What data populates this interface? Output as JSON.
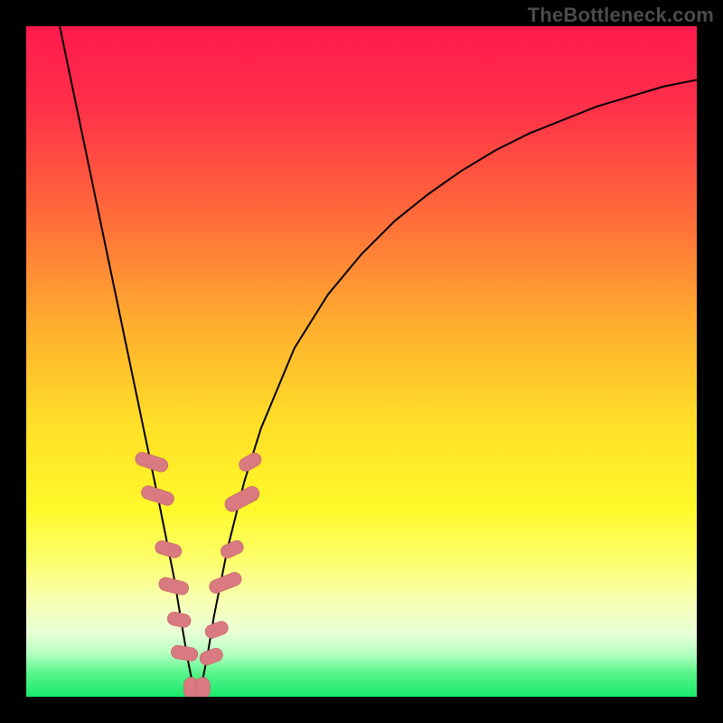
{
  "watermark": "TheBottleneck.com",
  "colors": {
    "frame": "#000000",
    "watermark": "#4b4b4b",
    "gradient_stops": [
      {
        "offset": 0.0,
        "color": "#ff1a4d"
      },
      {
        "offset": 0.12,
        "color": "#ff3049"
      },
      {
        "offset": 0.28,
        "color": "#ff6a3a"
      },
      {
        "offset": 0.45,
        "color": "#ffb02e"
      },
      {
        "offset": 0.6,
        "color": "#ffe128"
      },
      {
        "offset": 0.72,
        "color": "#fff92a"
      },
      {
        "offset": 0.8,
        "color": "#fcff6f"
      },
      {
        "offset": 0.86,
        "color": "#f7ffb6"
      },
      {
        "offset": 0.905,
        "color": "#e8ffd6"
      },
      {
        "offset": 0.935,
        "color": "#b6ffc1"
      },
      {
        "offset": 0.965,
        "color": "#57f48a"
      },
      {
        "offset": 1.0,
        "color": "#19e86b"
      }
    ],
    "curve": "#000000",
    "marker_fill": "#d97a80",
    "marker_stroke": "#c5636a"
  },
  "chart_data": {
    "type": "line",
    "title": "",
    "xlabel": "",
    "ylabel": "",
    "xlim": [
      0,
      100
    ],
    "ylim": [
      0,
      100
    ],
    "grid": false,
    "series": [
      {
        "name": "bottleneck-curve",
        "x": [
          5,
          7.5,
          10,
          12.5,
          15,
          17.5,
          20,
          21,
          22,
          23,
          24,
          25,
          26,
          27,
          28,
          30,
          32.5,
          35,
          40,
          45,
          50,
          55,
          60,
          65,
          70,
          75,
          80,
          85,
          90,
          95,
          100
        ],
        "y": [
          100,
          88,
          76,
          64,
          52,
          40,
          28,
          23,
          18,
          12,
          6,
          1,
          1,
          6,
          12,
          22,
          32,
          40,
          52,
          60,
          66,
          71,
          75,
          78.5,
          81.5,
          84,
          86,
          88,
          89.5,
          91,
          92
        ]
      }
    ],
    "markers": [
      {
        "shape": "pill",
        "x": 18.7,
        "y": 35.0,
        "w": 2.0,
        "h": 5.0,
        "angle": -72
      },
      {
        "shape": "pill",
        "x": 19.6,
        "y": 30.0,
        "w": 2.0,
        "h": 5.0,
        "angle": -72
      },
      {
        "shape": "pill",
        "x": 21.2,
        "y": 22.0,
        "w": 2.0,
        "h": 4.0,
        "angle": -74
      },
      {
        "shape": "pill",
        "x": 22.0,
        "y": 16.5,
        "w": 2.0,
        "h": 4.5,
        "angle": -76
      },
      {
        "shape": "pill",
        "x": 22.8,
        "y": 11.5,
        "w": 2.0,
        "h": 3.5,
        "angle": -78
      },
      {
        "shape": "pill",
        "x": 23.6,
        "y": 6.5,
        "w": 2.0,
        "h": 4.0,
        "angle": -80
      },
      {
        "shape": "pill",
        "x": 24.6,
        "y": 1.3,
        "w": 2.2,
        "h": 3.2,
        "angle": 0
      },
      {
        "shape": "pill",
        "x": 26.3,
        "y": 1.3,
        "w": 2.2,
        "h": 3.2,
        "angle": 0
      },
      {
        "shape": "pill",
        "x": 27.6,
        "y": 6.0,
        "w": 2.0,
        "h": 3.5,
        "angle": 70
      },
      {
        "shape": "pill",
        "x": 28.4,
        "y": 10.0,
        "w": 2.0,
        "h": 3.5,
        "angle": 70
      },
      {
        "shape": "pill",
        "x": 29.7,
        "y": 17.0,
        "w": 2.0,
        "h": 5.0,
        "angle": 68
      },
      {
        "shape": "pill",
        "x": 30.7,
        "y": 22.0,
        "w": 2.0,
        "h": 3.5,
        "angle": 66
      },
      {
        "shape": "pill",
        "x": 32.2,
        "y": 29.5,
        "w": 2.2,
        "h": 5.5,
        "angle": 62
      },
      {
        "shape": "pill",
        "x": 33.4,
        "y": 35.0,
        "w": 2.0,
        "h": 3.5,
        "angle": 60
      }
    ]
  }
}
